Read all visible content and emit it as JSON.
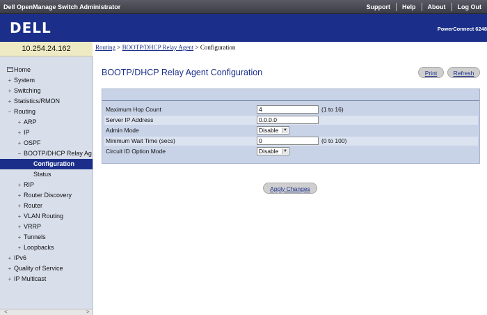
{
  "topbar": {
    "title": "Dell OpenManage Switch Administrator",
    "links": [
      "Support",
      "Help",
      "About",
      "Log Out"
    ]
  },
  "brand": {
    "logo": "DELL",
    "product": "PowerConnect 6248"
  },
  "device": {
    "ip": "10.254.24.162"
  },
  "breadcrumb": {
    "routing": "Routing",
    "sep1": " > ",
    "relay": "BOOTP/DHCP Relay Agent",
    "sep2": " > ",
    "current": "Configuration"
  },
  "page": {
    "title": "BOOTP/DHCP Relay Agent Configuration",
    "print": "Print",
    "refresh": "Refresh",
    "apply": "Apply Changes"
  },
  "nav": [
    {
      "label": "Home",
      "icon": "home-icon",
      "sign": ""
    },
    {
      "label": "System",
      "sign": "+"
    },
    {
      "label": "Switching",
      "sign": "+"
    },
    {
      "label": "Statistics/RMON",
      "sign": "+"
    },
    {
      "label": "Routing",
      "sign": "−"
    },
    {
      "label": "ARP",
      "sign": "+"
    },
    {
      "label": "IP",
      "sign": "+"
    },
    {
      "label": "OSPF",
      "sign": "+"
    },
    {
      "label": "BOOTP/DHCP Relay Ag",
      "sign": "−"
    },
    {
      "label": "Configuration",
      "sign": ""
    },
    {
      "label": "Status",
      "sign": ""
    },
    {
      "label": "RIP",
      "sign": "+"
    },
    {
      "label": "Router Discovery",
      "sign": "+"
    },
    {
      "label": "Router",
      "sign": "+"
    },
    {
      "label": "VLAN Routing",
      "sign": "+"
    },
    {
      "label": "VRRP",
      "sign": "+"
    },
    {
      "label": "Tunnels",
      "sign": "+"
    },
    {
      "label": "Loopbacks",
      "sign": "+"
    },
    {
      "label": "IPv6",
      "sign": "+"
    },
    {
      "label": "Quality of Service",
      "sign": "+"
    },
    {
      "label": "IP Multicast",
      "sign": "+"
    }
  ],
  "form": {
    "max_hop": {
      "label": "Maximum Hop Count",
      "value": "4",
      "hint": "(1 to 16)"
    },
    "server_ip": {
      "label": "Server IP Address",
      "value": "0.0.0.0"
    },
    "admin_mode": {
      "label": "Admin Mode",
      "value": "Disable"
    },
    "min_wait": {
      "label": "Minimum Wait Time (secs)",
      "value": "0",
      "hint": "(0 to 100)"
    },
    "circuit_id": {
      "label": "Circuit ID Option Mode",
      "value": "Disable"
    }
  },
  "scroll": {
    "left": "<",
    "right": ">"
  }
}
